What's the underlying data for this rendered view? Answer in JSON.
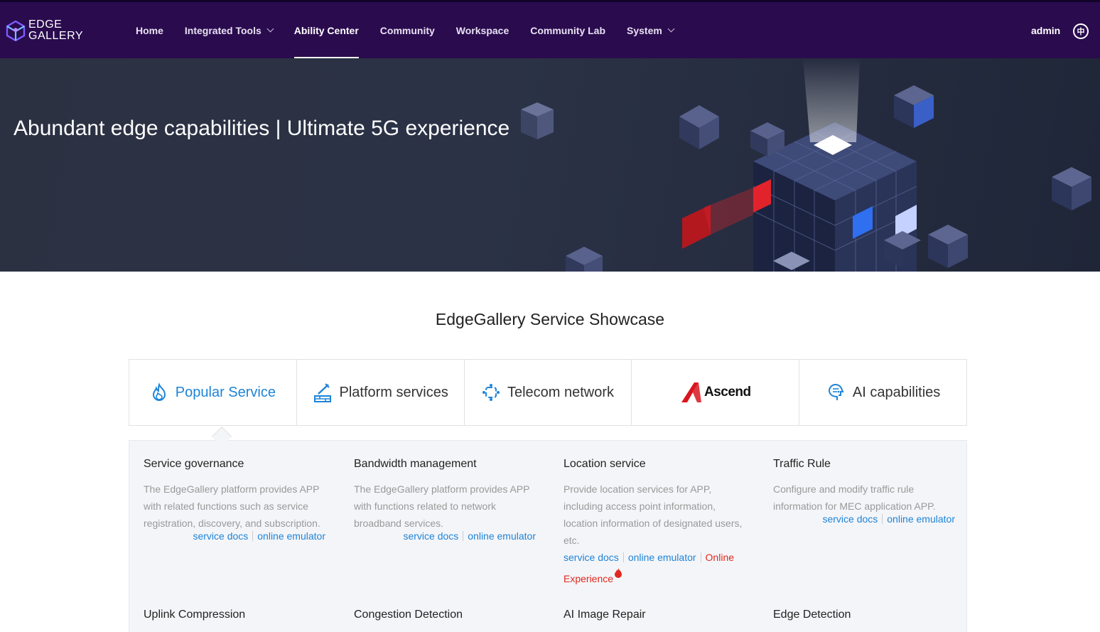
{
  "brand": {
    "line1": "EDGE",
    "line2": "GALLERY"
  },
  "nav": {
    "items": [
      {
        "label": "Home",
        "dropdown": false,
        "active": false
      },
      {
        "label": "Integrated Tools",
        "dropdown": true,
        "active": false
      },
      {
        "label": "Ability Center",
        "dropdown": false,
        "active": true
      },
      {
        "label": "Community",
        "dropdown": false,
        "active": false
      },
      {
        "label": "Workspace",
        "dropdown": false,
        "active": false
      },
      {
        "label": "Community Lab",
        "dropdown": false,
        "active": false
      },
      {
        "label": "System",
        "dropdown": true,
        "active": false
      }
    ],
    "user": "admin",
    "lang_glyph": "中"
  },
  "hero": {
    "title": "Abundant edge capabilities | Ultimate 5G experience"
  },
  "showcase": {
    "title": "EdgeGallery Service Showcase",
    "tabs": [
      {
        "label": "Popular Service",
        "icon": "flame-icon",
        "active": true
      },
      {
        "label": "Platform services",
        "icon": "platform-icon",
        "active": false
      },
      {
        "label": "Telecom network",
        "icon": "network-icon",
        "active": false
      },
      {
        "label": "Ascend",
        "icon": "ascend-logo",
        "active": false
      },
      {
        "label": "AI capabilities",
        "icon": "ai-head-icon",
        "active": false
      }
    ],
    "cards": [
      {
        "title": "Service governance",
        "desc": "The EdgeGallery platform provides APP with related functions such as service registration, discovery, and subscription.",
        "docs": "service docs",
        "emulator": "online emulator"
      },
      {
        "title": "Bandwidth management",
        "desc": "The EdgeGallery platform provides APP with functions related to network broadband services.",
        "docs": "service docs",
        "emulator": "online emulator"
      },
      {
        "title": "Location service",
        "desc": "Provide location services for APP, including access point information, location information of designated users, etc.",
        "docs": "service docs",
        "emulator": "online emulator",
        "experience": "Online Experience"
      },
      {
        "title": "Traffic Rule",
        "desc": "Configure and modify traffic rule information for MEC application APP.",
        "docs": "service docs",
        "emulator": "online emulator"
      },
      {
        "title": "Uplink Compression"
      },
      {
        "title": "Congestion Detection"
      },
      {
        "title": "AI Image Repair"
      },
      {
        "title": "Edge Detection"
      }
    ]
  },
  "colors": {
    "nav_bg": "#2a0b4e",
    "accent": "#1e84d8",
    "hot": "#e0281f"
  }
}
